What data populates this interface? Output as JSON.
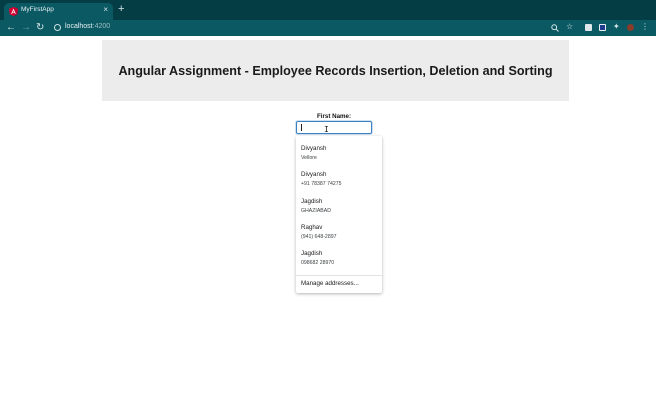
{
  "browser": {
    "tab_title": "MyFirstApp",
    "tab_close_glyph": "×",
    "new_tab_glyph": "+",
    "url_host": "localhost",
    "url_port": ":4200",
    "accent_color": "#0a5963",
    "favicon": "angular-icon"
  },
  "page": {
    "title": "Angular Assignment - Employee Records Insertion, Deletion and Sorting",
    "form": {
      "first_name_label": "First Name:",
      "first_name_value": ""
    }
  },
  "autofill": {
    "suggestions": [
      {
        "name": "Divyansh",
        "detail": "Vellore"
      },
      {
        "name": "Divyansh",
        "detail": "+91 78387 74275"
      },
      {
        "name": "Jagdish",
        "detail": "GHAZIABAD"
      },
      {
        "name": "Raghav",
        "detail": "(941) 648-2897"
      },
      {
        "name": "Jagdish",
        "detail": "098682 28970"
      }
    ],
    "manage_label": "Manage addresses..."
  }
}
